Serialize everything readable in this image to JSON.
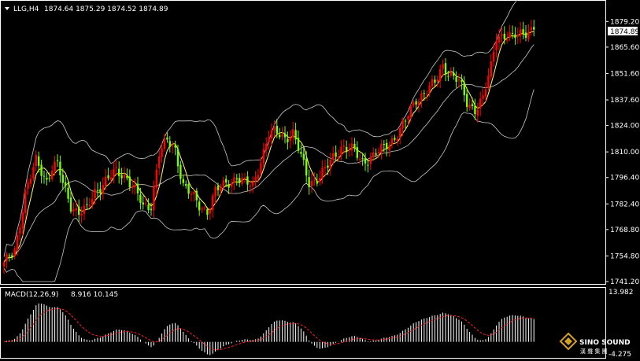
{
  "header": {
    "symbol_tf": "LLG,H4",
    "ohlc": "1874.64 1875.29 1874.52 1874.89"
  },
  "macd": {
    "label": "MACD(12,26,9)",
    "values": "8.916 10.145",
    "axis_max": "13.982",
    "axis_min": "-4.275"
  },
  "watermark": {
    "line1": "SINO SOUND",
    "line2": "漢 聲 集 團"
  },
  "colors": {
    "bull": "#ff0000",
    "bear": "#7cfc00",
    "ma": "#ffff66",
    "bands": "#c8c8c8",
    "histogram": "#ffffff",
    "signal": "#ff2020",
    "frame": "#ffffff",
    "price_box": "#ffffff"
  },
  "chart_data": [
    {
      "type": "candlestick",
      "symbol": "LLG",
      "timeframe": "H4",
      "last_price": "1874.89",
      "y_ticks": [
        "1879.20",
        "1865.60",
        "1851.60",
        "1837.60",
        "1824.00",
        "1810.00",
        "1796.40",
        "1782.40",
        "1768.80",
        "1754.80",
        "1741.20"
      ],
      "ylim": [
        1741.2,
        1881.0
      ],
      "grid": false,
      "anchors": [
        [
          0,
          1750
        ],
        [
          4,
          1758
        ],
        [
          8,
          1788
        ],
        [
          12,
          1805
        ],
        [
          16,
          1795
        ],
        [
          18,
          1802
        ],
        [
          20,
          1803
        ],
        [
          22,
          1793
        ],
        [
          25,
          1782
        ],
        [
          28,
          1778
        ],
        [
          31,
          1779
        ],
        [
          34,
          1789
        ],
        [
          38,
          1795
        ],
        [
          42,
          1799
        ],
        [
          46,
          1797
        ],
        [
          50,
          1787
        ],
        [
          52,
          1780
        ],
        [
          55,
          1782
        ],
        [
          58,
          1810
        ],
        [
          61,
          1815
        ],
        [
          64,
          1811
        ],
        [
          67,
          1793
        ],
        [
          70,
          1787
        ],
        [
          73,
          1781
        ],
        [
          76,
          1779
        ],
        [
          79,
          1789
        ],
        [
          83,
          1793
        ],
        [
          87,
          1797
        ],
        [
          90,
          1793
        ],
        [
          93,
          1792
        ],
        [
          96,
          1806
        ],
        [
          99,
          1819
        ],
        [
          102,
          1820
        ],
        [
          105,
          1818
        ],
        [
          108,
          1820
        ],
        [
          111,
          1807
        ],
        [
          114,
          1794
        ],
        [
          117,
          1796
        ],
        [
          120,
          1800
        ],
        [
          123,
          1807
        ],
        [
          126,
          1813
        ],
        [
          130,
          1811
        ],
        [
          134,
          1805
        ],
        [
          138,
          1808
        ],
        [
          142,
          1812
        ],
        [
          146,
          1818
        ],
        [
          150,
          1826
        ],
        [
          154,
          1838
        ],
        [
          158,
          1843
        ],
        [
          161,
          1846
        ],
        [
          164,
          1856
        ],
        [
          167,
          1851
        ],
        [
          170,
          1847
        ],
        [
          173,
          1836
        ],
        [
          176,
          1833
        ],
        [
          179,
          1838
        ],
        [
          182,
          1855
        ],
        [
          184,
          1872
        ],
        [
          187,
          1872
        ],
        [
          190,
          1870
        ],
        [
          193,
          1873
        ],
        [
          196,
          1875
        ],
        [
          198,
          1874.89
        ]
      ],
      "indicators": [
        "moving-average",
        "bollinger-bands"
      ]
    },
    {
      "type": "bar",
      "title": "MACD(12,26,9)",
      "values_label": "8.916 10.145",
      "ylim": [
        -4.275,
        13.982
      ],
      "y_ticks": [
        "13.982",
        "-4.275"
      ],
      "series": [
        "histogram",
        "signal"
      ]
    }
  ]
}
